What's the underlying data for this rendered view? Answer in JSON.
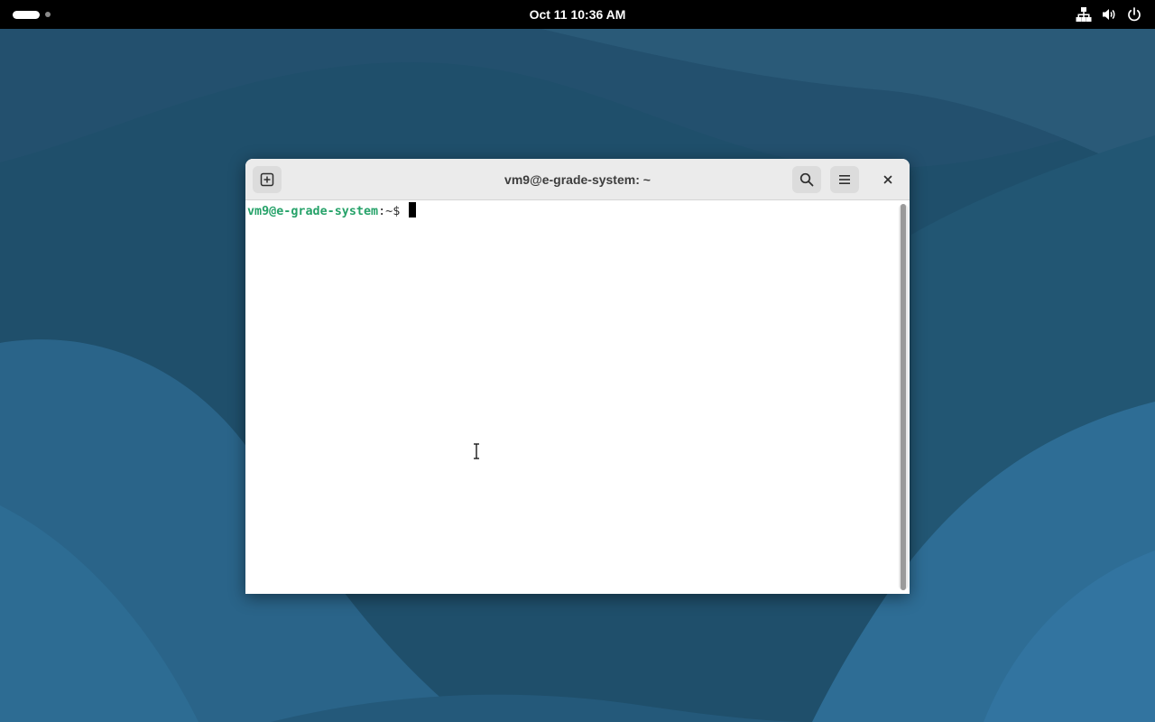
{
  "topbar": {
    "clock": "Oct 11  10:36 AM",
    "tray_icons": [
      "network-wired-icon",
      "volume-icon",
      "power-icon"
    ]
  },
  "window": {
    "title": "vm9@e-grade-system: ~",
    "buttons": [
      "new-tab-icon",
      "search-icon",
      "hamburger-menu-icon",
      "close-icon"
    ]
  },
  "terminal": {
    "prompt_user_host": "vm9@e-grade-system",
    "prompt_path": ":~$ ",
    "input": ""
  },
  "colors": {
    "wallpaper": "#1f4f6b",
    "prompt_green": "#26a269",
    "topbar": "#000000"
  }
}
